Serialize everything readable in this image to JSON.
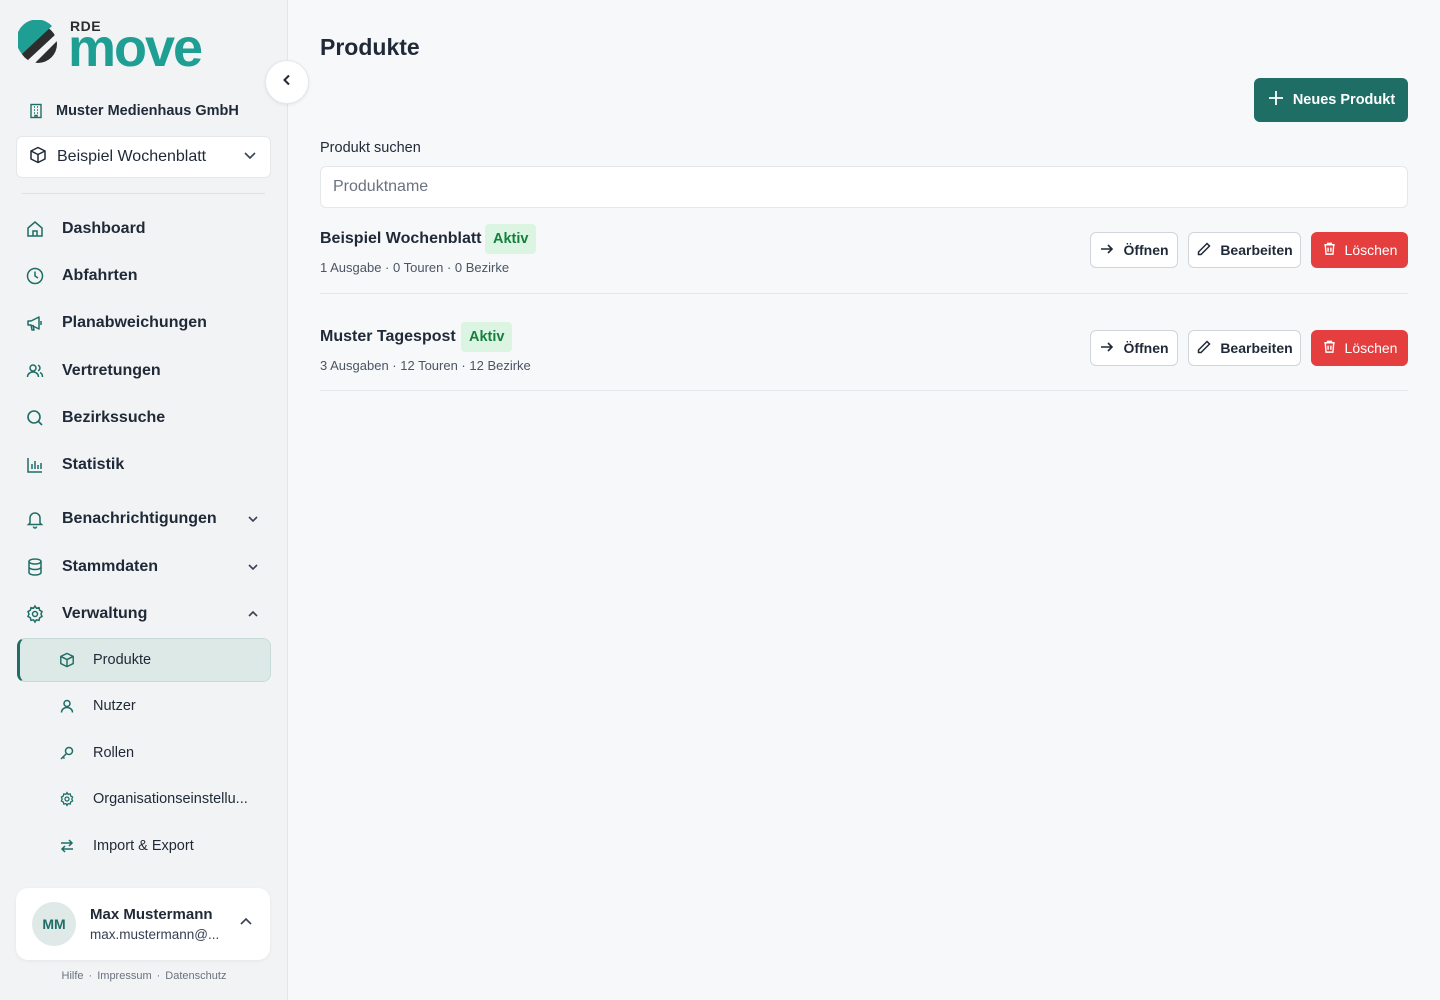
{
  "brand": {
    "prefix": "RDE",
    "name": "move"
  },
  "sidebar": {
    "organization": "Muster Medienhaus GmbH",
    "product_select": "Beispiel Wochenblatt",
    "nav": [
      {
        "label": "Dashboard",
        "icon": "home-icon"
      },
      {
        "label": "Abfahrten",
        "icon": "clock-icon"
      },
      {
        "label": "Planabweichungen",
        "icon": "megaphone-icon"
      },
      {
        "label": "Vertretungen",
        "icon": "users-icon"
      },
      {
        "label": "Bezirkssuche",
        "icon": "search-icon"
      },
      {
        "label": "Statistik",
        "icon": "bar-chart-icon"
      },
      {
        "label": "Benachrichtigungen",
        "icon": "bell-icon"
      },
      {
        "label": "Stammdaten",
        "icon": "database-icon"
      },
      {
        "label": "Verwaltung",
        "icon": "gear-icon"
      }
    ],
    "subnav": [
      {
        "label": "Produkte",
        "icon": "box-icon",
        "active": true
      },
      {
        "label": "Nutzer",
        "icon": "user-icon"
      },
      {
        "label": "Rollen",
        "icon": "key-icon"
      },
      {
        "label": "Organisationseinstellu...",
        "icon": "gear-icon"
      },
      {
        "label": "Import & Export",
        "icon": "arrows-icon"
      }
    ],
    "user": {
      "initials": "MM",
      "name": "Max Mustermann",
      "email": "max.mustermann@..."
    },
    "footer": [
      "Hilfe",
      "Impressum",
      "Datenschutz"
    ]
  },
  "main": {
    "title": "Produkte",
    "new_button": "Neues Produkt",
    "search_label": "Produkt suchen",
    "search_placeholder": "Produktname",
    "products": [
      {
        "name": "Beispiel Wochenblatt",
        "status": "Aktiv",
        "meta": "1 Ausgabe · 0 Touren · 0 Bezirke"
      },
      {
        "name": "Muster Tagespost",
        "status": "Aktiv",
        "meta": "3 Ausgaben · 12 Touren · 12 Bezirke"
      }
    ],
    "actions": {
      "open": "Öffnen",
      "edit": "Bearbeiten",
      "delete": "Löschen"
    }
  },
  "colors": {
    "accent": "#1f6e66",
    "brand": "#1f9e93",
    "danger": "#e53e3e",
    "badge_bg": "#dcf5e3",
    "badge_text": "#15803d"
  }
}
